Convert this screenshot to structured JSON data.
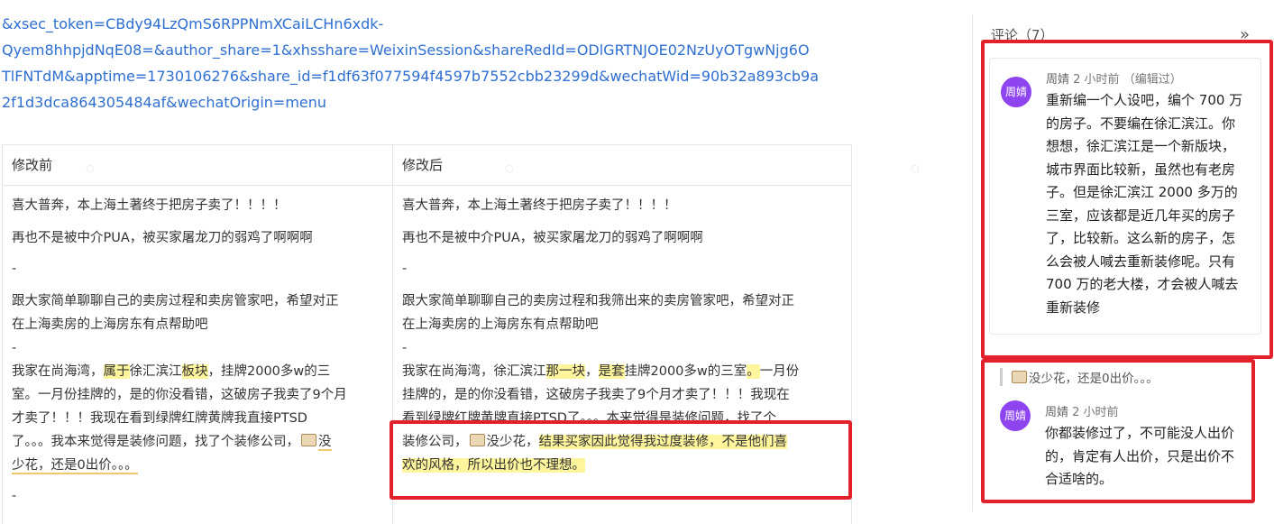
{
  "url_lines": [
    "&xsec_token=CBdy94LzQmS6RPPNmXCaiLCHn6xdk-",
    "Qyem8hhpjdNqE08=&author_share=1&xhsshare=WeixinSession&shareRedId=ODlGRTNJOE02NzUyOTgwNjg6O",
    "TlFNTdM&apptime=1730106276&share_id=f1df63f077594f4597b7552cbb23299d&wechatWid=90b32a893cb9a",
    "2f1d3dca864305484af&wechatOrigin=menu"
  ],
  "compare": {
    "before_header": "修改前",
    "after_header": "修改后",
    "before": {
      "l1": "喜大普奔，本上海土著终于把房子卖了！！！！",
      "l2": "再也不是被中介PUA，被买家屠龙刀的弱鸡了啊啊啊",
      "l3": "-",
      "l4a": "跟大家简单聊聊自己的卖房过程和卖房管家吧，希望对正",
      "l4b": "在上海卖房的上海房东有点帮助吧",
      "l5": "-",
      "l6a_pre": "我家在尚海湾，",
      "l6a_hl1": "属于",
      "l6a_mid": "徐汇滨江",
      "l6a_hl2": "板块",
      "l6a_post": "，挂牌2000多w的三",
      "l6b": "室。一月份挂牌的，是的你没看错，这破房子我卖了9个月",
      "l6c": "才卖了！！！我现在看到绿牌红牌黄牌我直接PTSD",
      "l6d": "了。。。我本来觉得是装修问题，找了个装修公司，",
      "l6d_emoji": "money-bag-emoji",
      "l6d_end": "没",
      "l6e": "少花，还是0出价。。。",
      "l7": "-"
    },
    "after": {
      "l1": "喜大普奔，本上海土著终于把房子卖了！！！！",
      "l2": "再也不是被中介PUA，被买家屠龙刀的弱鸡了啊啊啊",
      "l3": "-",
      "l4a": "跟大家简单聊聊自己的卖房过程和我筛出来的卖房管家吧，希望对正",
      "l4b": "在上海卖房的上海房东有点帮助吧",
      "l5": "-",
      "l6a_pre": "我家在尚海湾，徐汇滨江",
      "l6a_hl1": "那一块",
      "l6a_mid": "，",
      "l6a_hl2": "是套",
      "l6a_post": "挂牌2000多w的三室",
      "l6a_hl3": "。",
      "l6a_tail": "一月份",
      "l6b": "挂牌的，是的你没看错，这破房子我卖了9个月才卖了！！！我现在",
      "l6c": "看到绿牌红牌黄牌直接PTSD了。。。本来觉得是装修问题，找了个",
      "l6d_pre": "装修公司，",
      "l6d_mid": "没少花，",
      "l6d_hl": "结果买家因此觉得我过度装修，不是他们喜",
      "l6e_hl": "欢的风格，所以出价也不理想。"
    }
  },
  "comments_panel": {
    "title": "评论（7）",
    "collapse_icon": "double-chevron-right-icon",
    "comment1": {
      "avatar": "周婧",
      "author": "周婧",
      "time": "2 小时前",
      "edited": "（编辑过）",
      "lines": [
        "重新编一个人设吧，编个 700 万",
        "的房子。不要编在徐汇滨江。你",
        "想想，徐汇滨江是一个新版块，",
        "城市界面比较新，虽然也有老房",
        "子。但是徐汇滨江 2000 多万的",
        "三室，应该都是近几年买的房子",
        "了，比较新。这么新的房子，怎",
        "么会被人喊去重新装修呢。只有",
        "700 万的老大楼，才会被人喊去",
        "重新装修"
      ]
    },
    "quote": "没少花，还是0出价。。。",
    "comment2": {
      "avatar": "周婧",
      "author": "周婧",
      "time": "2 小时前",
      "lines": [
        "你都装修过了，不可能没人出价",
        "的，肯定有人出价，只是出价不",
        "合适啥的。"
      ]
    }
  },
  "colors": {
    "link": "#2e6fd1",
    "highlight": "#fff59d",
    "avatar": "#8e44ef",
    "annotation_red": "#e3212b"
  }
}
